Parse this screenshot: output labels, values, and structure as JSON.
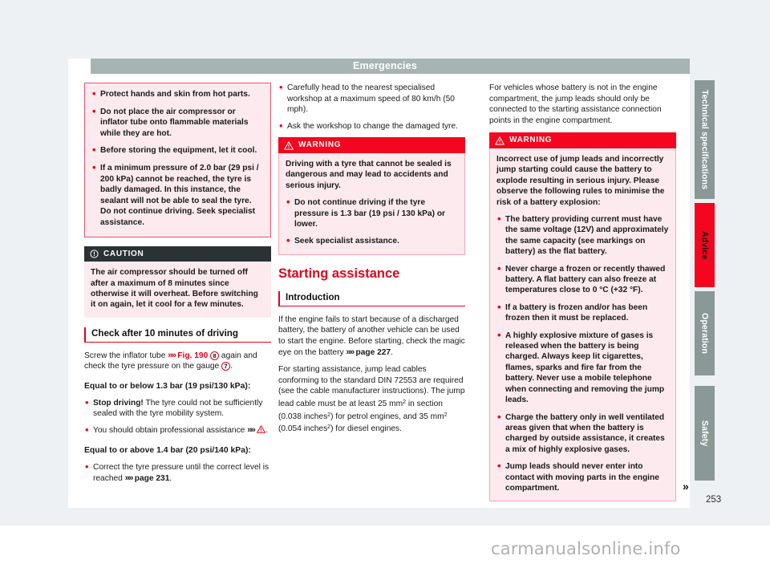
{
  "header": {
    "title": "Emergencies"
  },
  "column1": {
    "notebox": {
      "items": [
        "Protect hands and skin from hot parts.",
        "Do not place the air compressor or inflator tube onto flammable materials while they are hot.",
        "Before storing the equipment, let it cool.",
        "If a minimum pressure of 2.0 bar (29 psi / 200 kPa) cannot be reached, the tyre is badly damaged. In this instance, the sealant will not be able to seal the tyre. Do not continue driving. Seek specialist assistance."
      ]
    },
    "caution": {
      "icon": "caution-circle-icon",
      "label": "CAUTION",
      "body": "The air compressor should be turned off after a maximum of 8 minutes since otherwise it will overheat. Before switching it on again, let it cool for a few minutes."
    },
    "heading": "Check after 10 minutes of driving",
    "intro_pre": "Screw the inflator tube ",
    "intro_ref": "Fig. 190",
    "intro_circ1": "8",
    "intro_mid": " again and check the tyre pressure on the gauge ",
    "intro_circ2": "7",
    "intro_end": ".",
    "heading_below": "Equal to or below 1.3 bar (19 psi/130 kPa):",
    "below_items": [
      {
        "strong": "Stop driving!",
        "rest": " The tyre could not be sufficiently sealed with the tyre mobility system."
      },
      {
        "strong": "",
        "rest": "You should obtain professional assistance "
      }
    ],
    "heading_above": "Equal to or above 1.4 bar (20 psi/140 kPa):",
    "above_item_pre": "Correct the tyre pressure until the correct level is reached ",
    "above_item_ref": "page 231",
    "above_item_end": "."
  },
  "column2": {
    "bullets": [
      "Carefully head to the nearest specialised workshop at a maximum speed of 80 km/h (50 mph).",
      "Ask the workshop to change the damaged tyre."
    ],
    "warning": {
      "icon": "warning-triangle-icon",
      "label": "WARNING",
      "intro": "Driving with a tyre that cannot be sealed is dangerous and may lead to accidents and serious injury.",
      "items": [
        "Do not continue driving if the tyre pressure is 1.3 bar (19 psi / 130 kPa) or lower.",
        "Seek specialist assistance."
      ]
    },
    "section_title": "Starting assistance",
    "sub_title": "Introduction",
    "para1_pre": "If the engine fails to start because of a discharged battery, the battery of another vehicle can be used to start the engine. Before starting, check the magic eye on the battery ",
    "para1_ref": "page 227",
    "para1_end": ".",
    "para2_a": "For starting assistance, jump lead cables conforming to the standard DIN 72553 are required (see the cable manufacturer instructions). The jump lead cable must be at least 25 mm",
    "para2_b": " in section (0.038 inches",
    "para2_c": ") for petrol engines, and 35 mm",
    "para2_d": " (0.054 inches",
    "para2_e": ") for diesel engines.",
    "sup2": "2"
  },
  "column3": {
    "para1": "For vehicles whose battery is not in the engine compartment, the jump leads should only be connected to the starting assistance connection points in the engine compartment.",
    "warning": {
      "icon": "warning-triangle-icon",
      "label": "WARNING",
      "intro": "Incorrect use of jump leads and incorrectly jump starting could cause the battery to explode resulting in serious injury. Please observe the following rules to minimise the risk of a battery explosion:",
      "items": [
        "The battery providing current must have the same voltage (12V) and approximately the same capacity (see markings on battery) as the flat battery.",
        "Never charge a frozen or recently thawed battery. A flat battery can also freeze at temperatures close to 0 °C (+32 °F).",
        "If a battery is frozen and/or has been frozen then it must be replaced.",
        "A highly explosive mixture of gases is released when the battery is being charged. Always keep lit cigarettes, flames, sparks and fire far from the battery. Never use a mobile telephone when connecting and removing the jump leads.",
        "Charge the battery only in well ventilated areas given that when the battery is charged by outside assistance, it creates a mix of highly explosive gases.",
        "Jump leads should never enter into contact with moving parts in the engine compartment."
      ]
    }
  },
  "rail": {
    "tabs": [
      {
        "label": "Technical specifications",
        "active": false
      },
      {
        "label": "Advice",
        "active": true
      },
      {
        "label": "Operation",
        "active": false
      },
      {
        "label": "Safety",
        "active": false
      }
    ]
  },
  "footer": {
    "continuation_arrow": "»",
    "page_number": "253",
    "watermark": "carmanualsonline.info"
  },
  "colors": {
    "brand_red": "#e2001a",
    "warning_red": "#f3061e",
    "caution_dark": "#2b3236",
    "note_pink": "#fdeaee",
    "header_grey": "#a6b4b4",
    "tab_grey": "#8a9896"
  }
}
